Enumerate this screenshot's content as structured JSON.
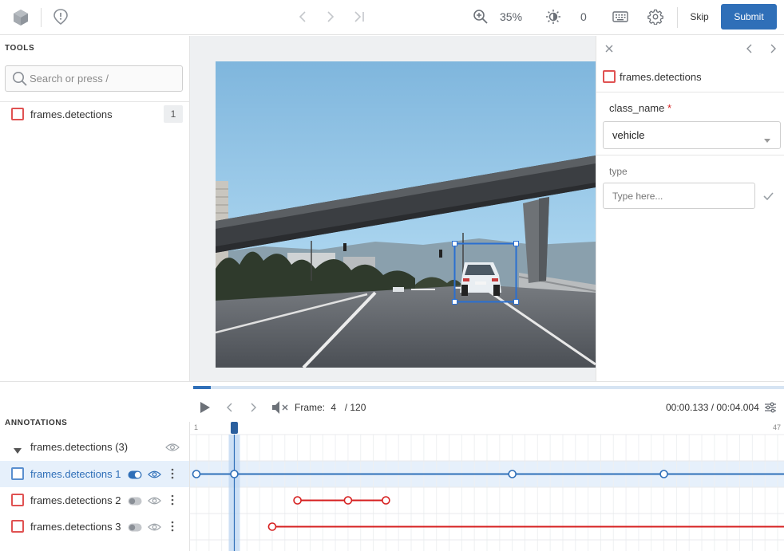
{
  "toolbar": {
    "zoom": "35%",
    "brightness": "0",
    "skip_label": "Skip",
    "submit_label": "Submit"
  },
  "tools": {
    "section_label": "TOOLS",
    "search_placeholder": "Search or press /",
    "items": [
      {
        "label": "frames.detections",
        "count": "1",
        "color": "#e05252"
      }
    ]
  },
  "attributes": {
    "object_label": "frames.detections",
    "class_field_label": "class_name",
    "required_mark": "*",
    "class_value": "vehicle",
    "type_label": "type",
    "type_placeholder": "Type here..."
  },
  "player": {
    "frame_label": "Frame:",
    "frame_current": "4",
    "frame_total": "/ 120",
    "time": "00:00.133 / 00:04.004",
    "progress": 0.03
  },
  "timeline": {
    "scale_start": "1",
    "scale_end": "47",
    "cursor_frame": 4
  },
  "annotations": {
    "section_label": "ANNOTATIONS",
    "group_label": "frames.detections (3)",
    "tracks": [
      {
        "label": "frames.detections 1",
        "color": "#2f6fb8",
        "selected": true,
        "keyframes": [
          1,
          4,
          26,
          38
        ],
        "segments": [
          [
            1,
            47
          ]
        ]
      },
      {
        "label": "frames.detections 2",
        "color": "#d62020",
        "selected": false,
        "keyframes": [
          9,
          13,
          16
        ],
        "segments": [
          [
            9,
            16
          ]
        ]
      },
      {
        "label": "frames.detections 3",
        "color": "#d62020",
        "selected": false,
        "keyframes": [
          7
        ],
        "segments": [
          [
            7,
            47
          ]
        ]
      }
    ]
  },
  "colors": {
    "accent": "#2f6fb8",
    "submit_bg": "#2f6fb8",
    "track_selected_bg": "#e6f0fb",
    "cursor": "#2f6fb8",
    "unselected_track": "#d62020"
  }
}
